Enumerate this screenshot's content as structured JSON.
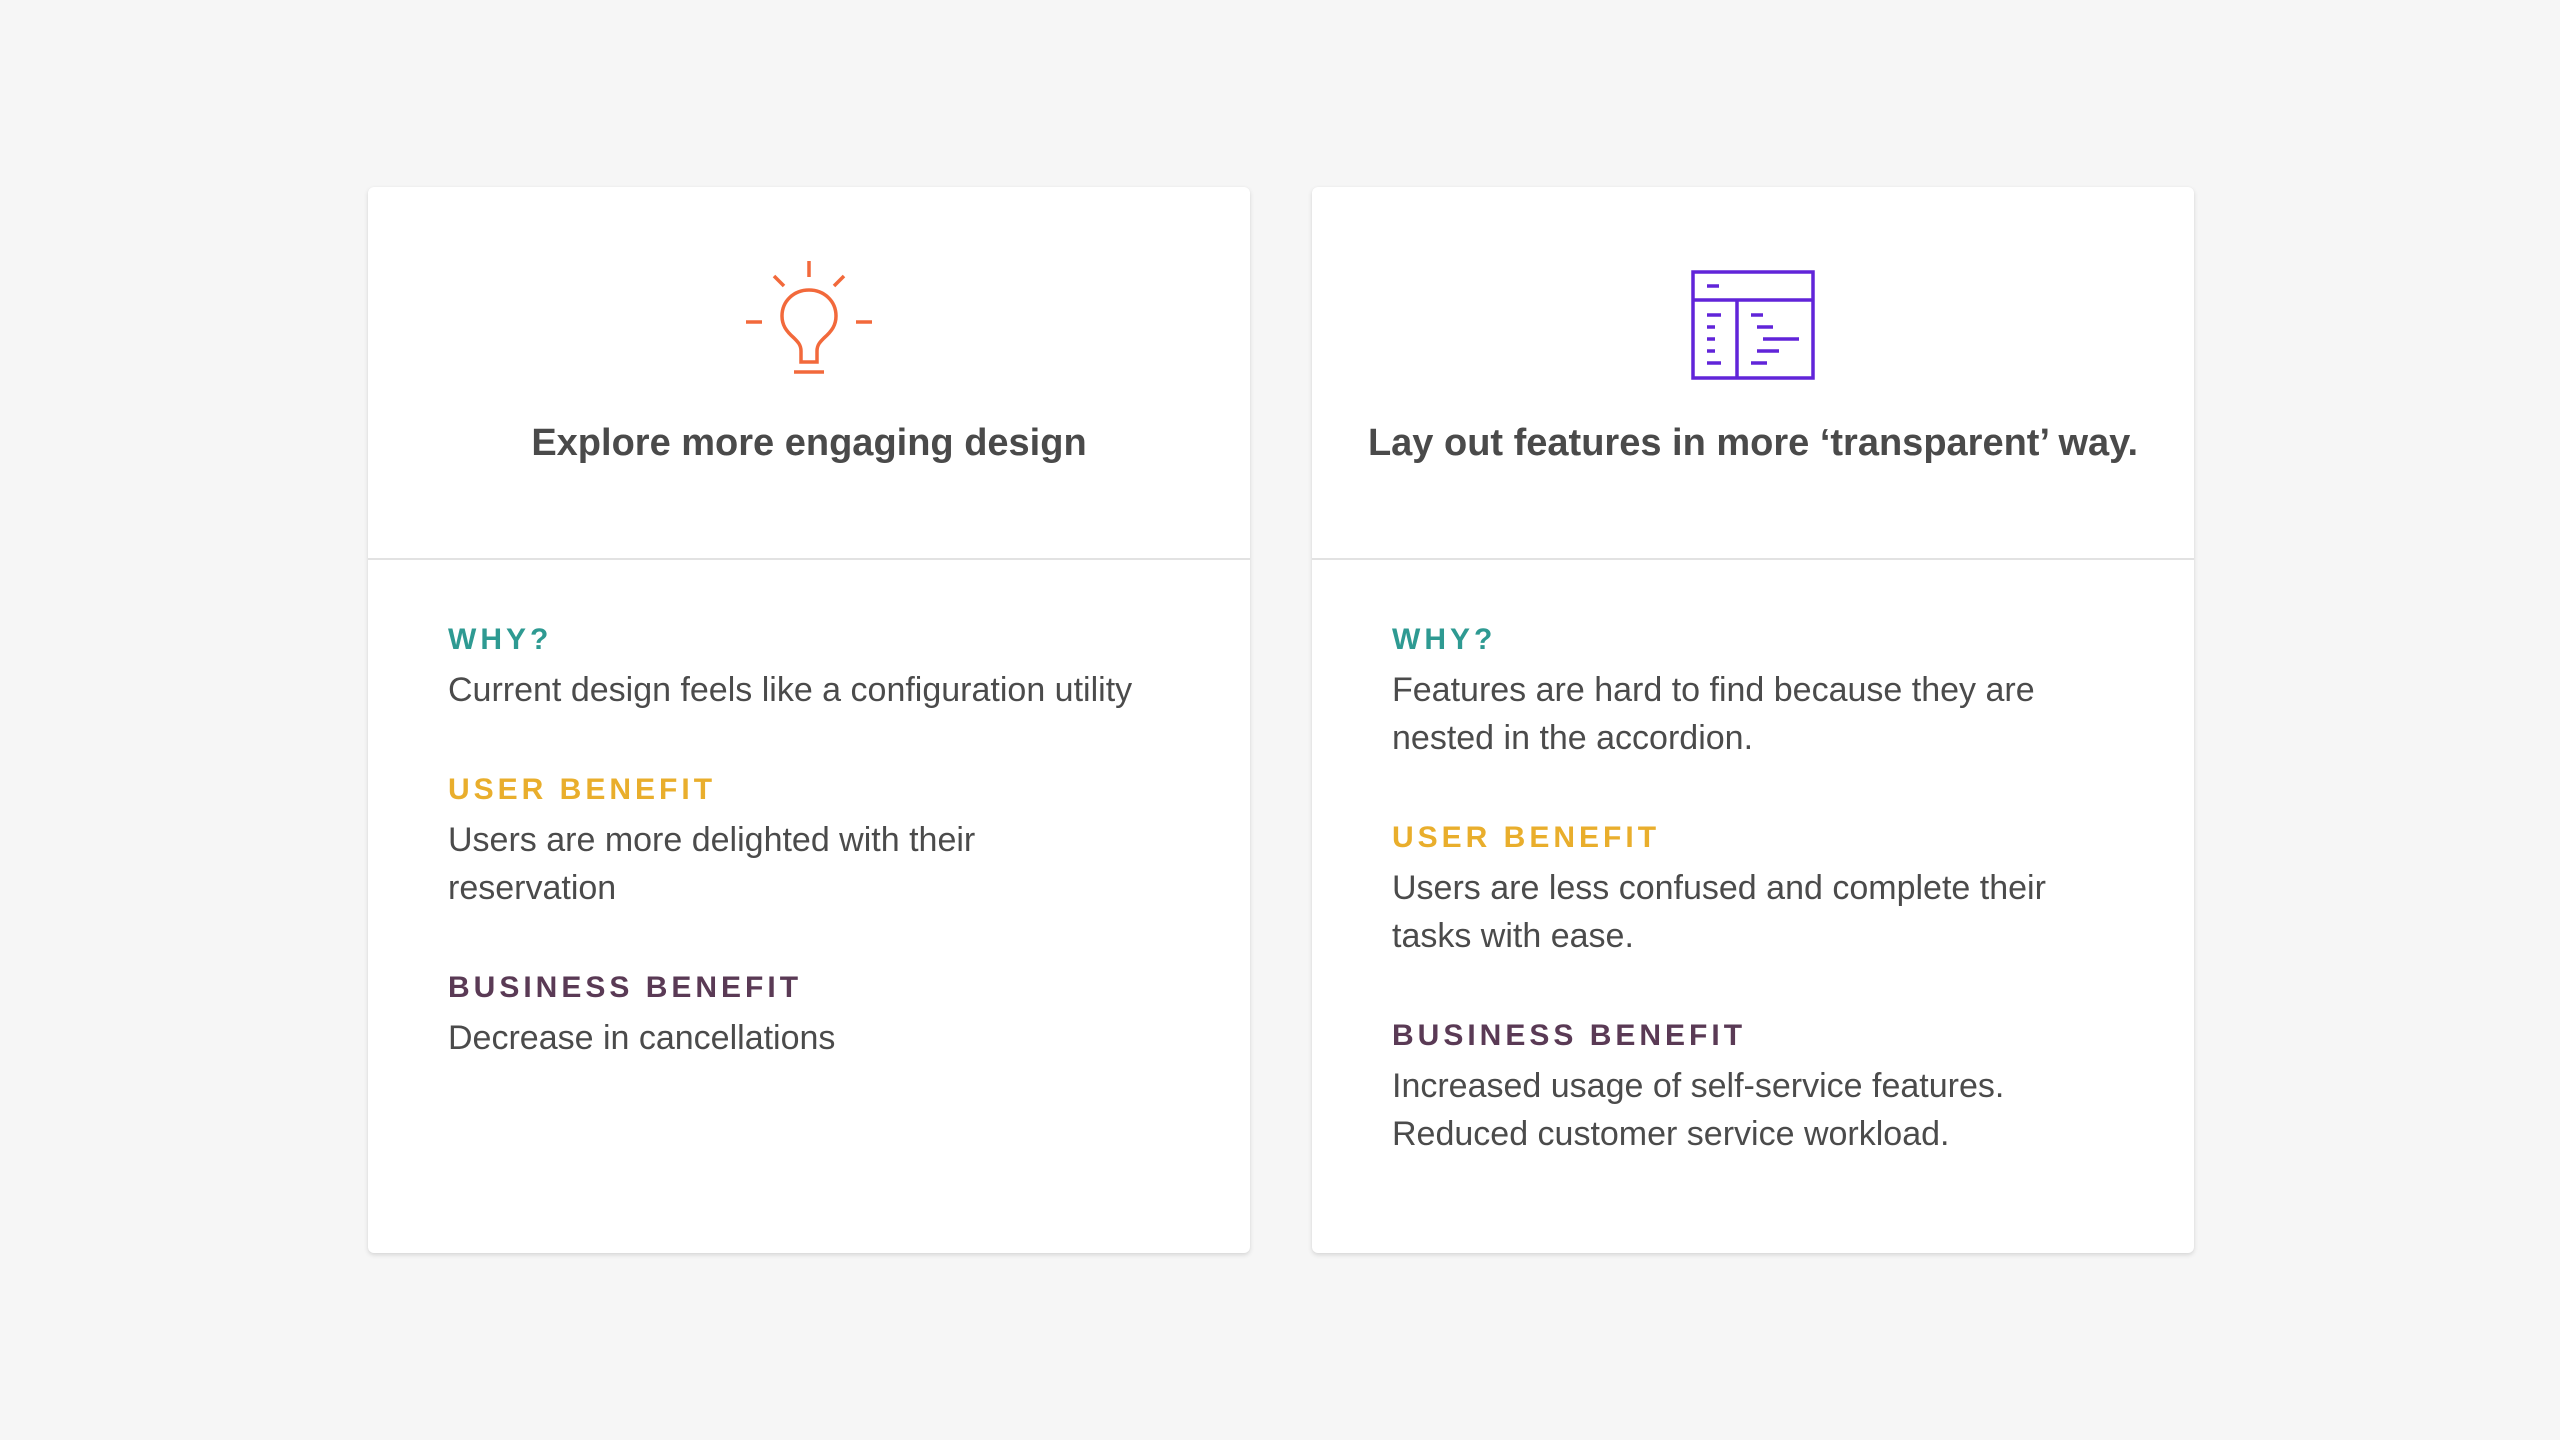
{
  "colors": {
    "background": "#f6f6f6",
    "card": "#ffffff",
    "why_label": "#2e9a92",
    "user_benefit_label": "#e9ae2c",
    "business_benefit_label": "#5a3a55",
    "lightbulb_icon": "#f2693b",
    "layout_icon": "#6124d9"
  },
  "cards": [
    {
      "icon": "lightbulb-icon",
      "title": "Explore more engaging design",
      "sections": [
        {
          "label": "WHY?",
          "text": "Current design feels like a configuration utility"
        },
        {
          "label": "USER BENEFIT",
          "text": "Users are more delighted with their\nreservation"
        },
        {
          "label": "BUSINESS BENEFIT",
          "text": "Decrease in cancellations"
        }
      ]
    },
    {
      "icon": "layout-window-icon",
      "title": "Lay out features in more ‘transparent’ way.",
      "sections": [
        {
          "label": "WHY?",
          "text": "Features are hard to find because they are\nnested in the accordion."
        },
        {
          "label": "USER BENEFIT",
          "text": "Users are less confused and complete their\ntasks with ease."
        },
        {
          "label": "BUSINESS BENEFIT",
          "text": "Increased usage of self-service features.\nReduced customer service workload."
        }
      ]
    }
  ]
}
